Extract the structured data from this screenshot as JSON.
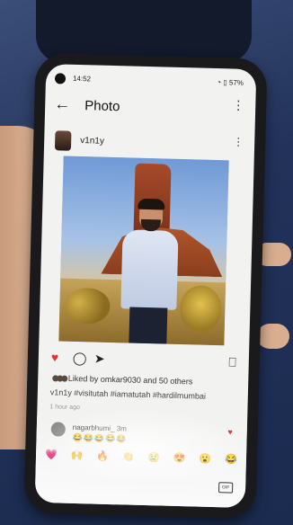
{
  "status_bar": {
    "time": "14:52",
    "battery": "57%"
  },
  "app_bar": {
    "title": "Photo",
    "back_icon": "arrow-left-icon",
    "menu_icon": "more-vertical-icon"
  },
  "post": {
    "username": "v1n1y",
    "likes_prefix": "Liked by",
    "liked_by_user": "omkar9030",
    "likes_suffix": "and 50 others",
    "caption": "v1n1y #visitutah #iamatutah #hardilmumbai",
    "time_ago": "1 hour ago"
  },
  "comment": {
    "user": "nagarbhumi_  3m",
    "text": "😂😂😂😂😂"
  },
  "reactions": [
    "💗",
    "🙌",
    "🔥",
    "👏",
    "😢",
    "😍",
    "😮",
    "😂"
  ],
  "gif_label": "GIF",
  "colors": {
    "like_red": "#e23030",
    "screen_bg": "#f2f2f0"
  }
}
